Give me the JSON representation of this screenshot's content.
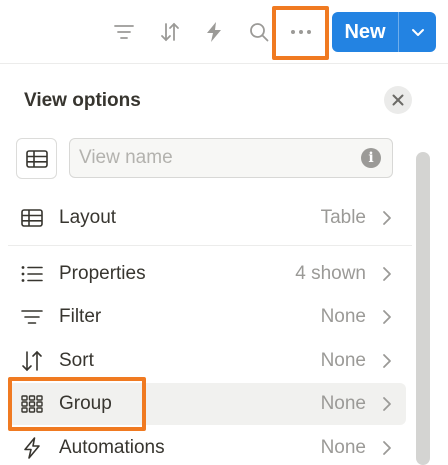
{
  "toolbar": {
    "icons": [
      "filter-icon",
      "sort-icon",
      "lightning-icon",
      "search-icon",
      "more-icon"
    ],
    "new_label": "New",
    "brand_color": "#2383e2",
    "highlight_color": "#f07a21"
  },
  "panel": {
    "title": "View options",
    "view_name_placeholder": "View name",
    "view_name_value": "",
    "info_glyph": "i"
  },
  "rows": [
    {
      "label": "Layout",
      "value": "Table",
      "icon": "table-icon"
    },
    {
      "label": "Properties",
      "value": "4 shown",
      "icon": "list-icon"
    },
    {
      "label": "Filter",
      "value": "None",
      "icon": "filter-icon"
    },
    {
      "label": "Sort",
      "value": "None",
      "icon": "sort-icon"
    },
    {
      "label": "Group",
      "value": "None",
      "icon": "group-icon"
    },
    {
      "label": "Automations",
      "value": "None",
      "icon": "lightning-icon"
    }
  ]
}
